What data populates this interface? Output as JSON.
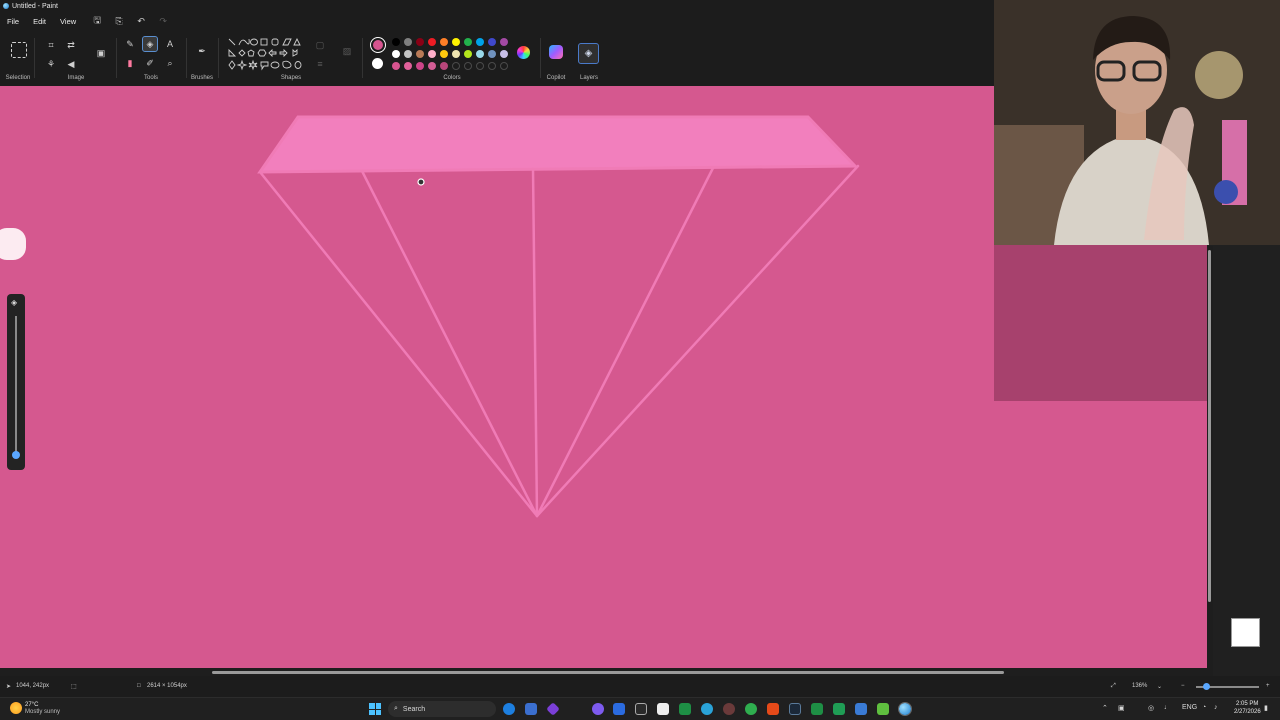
{
  "window": {
    "title": "Untitled - Paint"
  },
  "menu": {
    "items": [
      "File",
      "Edit",
      "View"
    ]
  },
  "ribbon": {
    "groups": {
      "selection": "Selection",
      "image": "Image",
      "tools": "Tools",
      "brushes": "Brushes",
      "shapes": "Shapes",
      "colors": "Colors",
      "copilot": "Copilot",
      "layers": "Layers"
    },
    "text_tool_glyph": "A",
    "primary_color": "#d7548f",
    "secondary_color": "#ffffff",
    "palette_row1": [
      "#000000",
      "#7f7f7f",
      "#880015",
      "#ed1c24",
      "#ff7f27",
      "#fff200",
      "#22b14c",
      "#00a2e8",
      "#3f48cc",
      "#a349a4"
    ],
    "palette_row2": [
      "#ffffff",
      "#c3c3c3",
      "#b97a57",
      "#ffaec9",
      "#ffc90e",
      "#efe4b0",
      "#b5e61d",
      "#99d9ea",
      "#7092be",
      "#c8bfe7"
    ],
    "palette_row3": [
      "#d7548f",
      "#e0609a",
      "#cc4488",
      "#d35d95",
      "#b8467a",
      "",
      "",
      "",
      "",
      ""
    ]
  },
  "canvas": {
    "background": "#d5588f",
    "stroke_color": "#f07bb6",
    "fill_color": "#f27fbd"
  },
  "status": {
    "cursor_position": "1044, 242px",
    "canvas_size": "2614 × 1054px",
    "zoom": "136%"
  },
  "taskbar": {
    "weather_temp": "27°C",
    "weather_desc": "Mostly sunny",
    "search_placeholder": "Search",
    "language": "ENG",
    "time": "2:05 PM",
    "date": "2/27/2026"
  }
}
